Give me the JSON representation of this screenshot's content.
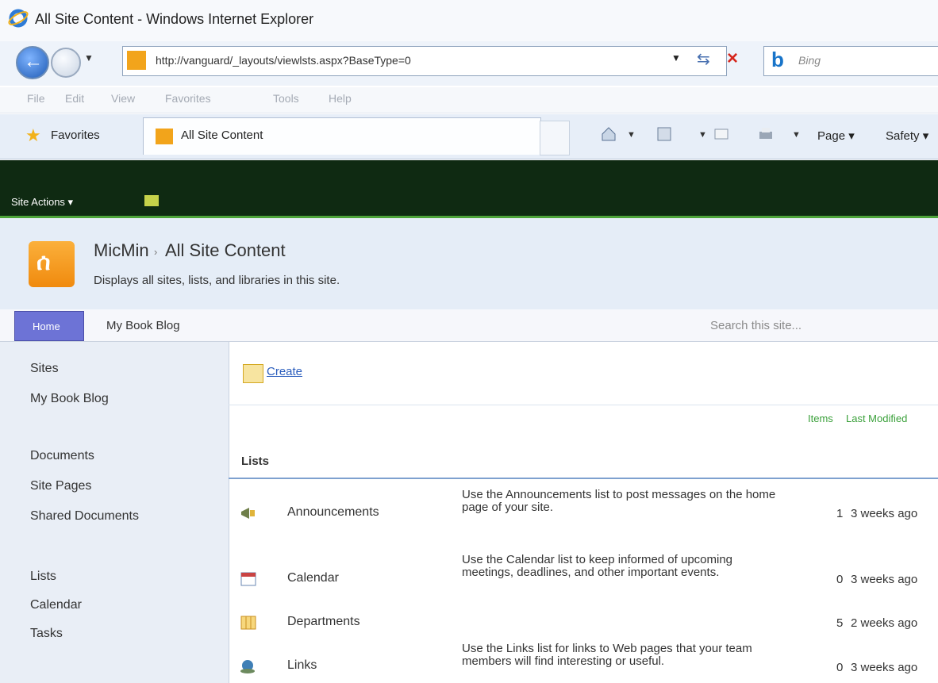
{
  "window": {
    "title": "All Site Content - Windows Internet Explorer"
  },
  "browser": {
    "address": "http://vanguard/_layouts/viewlsts.aspx?BaseType=0",
    "search_placeholder": "Bing",
    "menu": [
      "File",
      "Edit",
      "View",
      "Favorites",
      "Tools",
      "Help"
    ],
    "favorites_label": "Favorites",
    "tab_label": "All Site Content",
    "page_label": "Page ▾",
    "safety_label": "Safety ▾"
  },
  "sharepoint": {
    "site_actions": "Site Actions ▾",
    "site_name": "MicMin",
    "breadcrumb_sep": "›",
    "page_title": "All Site Content",
    "page_description": "Displays all sites, lists, and libraries in this site.",
    "nav_tabs": [
      "Home",
      "My Book Blog"
    ],
    "search_placeholder": "Search this site...",
    "quick_launch": {
      "sites_header": "Sites",
      "sites": [
        "My Book Blog"
      ],
      "documents_header": "Documents",
      "documents": [
        "Site Pages",
        "Shared Documents"
      ],
      "lists_header": "Lists",
      "lists": [
        "Calendar",
        "Tasks"
      ]
    },
    "create_label": "Create",
    "columns": {
      "items": "Items",
      "last_modified": "Last Modified"
    },
    "lists_header": "Lists",
    "rows": [
      {
        "title": "Announcements",
        "desc": "Use the Announcements list to post messages on the home page of your site.",
        "count": "1",
        "modified": "3 weeks ago"
      },
      {
        "title": "Calendar",
        "desc": "Use the Calendar list to keep informed of upcoming meetings, deadlines, and other important events.",
        "count": "0",
        "modified": "3 weeks ago"
      },
      {
        "title": "Departments",
        "desc": "",
        "count": "5",
        "modified": "2 weeks ago"
      },
      {
        "title": "Links",
        "desc": "Use the Links list for links to Web pages that your team members will find interesting or useful.",
        "count": "0",
        "modified": "3 weeks ago"
      }
    ]
  }
}
